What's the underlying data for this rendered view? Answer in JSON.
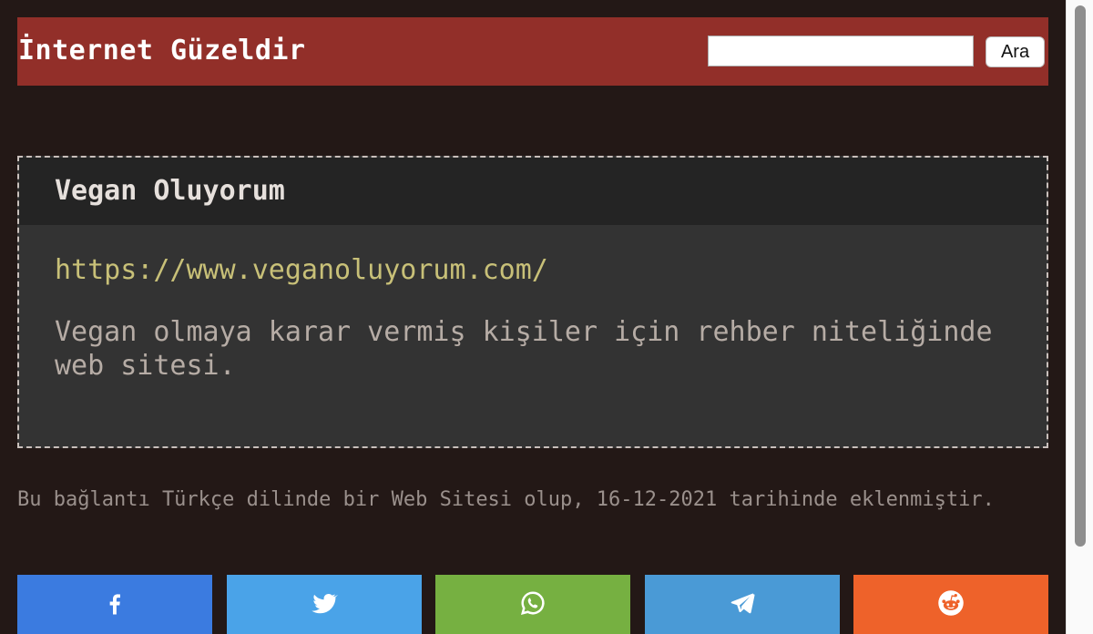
{
  "header": {
    "site_title": "İnternet Güzeldir",
    "search": {
      "value": "",
      "button_label": "Ara"
    }
  },
  "entry": {
    "title": "Vegan Oluyorum",
    "url": "https://www.veganoluyorum.com/",
    "description": "Vegan olmaya karar vermiş kişiler için rehber niteliğinde web sitesi."
  },
  "footer": {
    "note": "Bu bağlantı Türkçe dilinde bir Web Sitesi olup, 16-12-2021 tarihinde eklenmiştir."
  },
  "share": [
    {
      "name": "facebook",
      "icon": "facebook-icon",
      "color": "#3b7be0"
    },
    {
      "name": "twitter",
      "icon": "twitter-icon",
      "color": "#4aa3e8"
    },
    {
      "name": "whatsapp",
      "icon": "whatsapp-icon",
      "color": "#76b041"
    },
    {
      "name": "telegram",
      "icon": "telegram-icon",
      "color": "#4a9ad6"
    },
    {
      "name": "reddit",
      "icon": "reddit-icon",
      "color": "#ee622a"
    }
  ],
  "colors": {
    "page_bg": "#231816",
    "header_bg": "#922f29",
    "card_header_bg": "#242424",
    "card_body_bg": "#333333",
    "url_color": "#c8c078"
  }
}
